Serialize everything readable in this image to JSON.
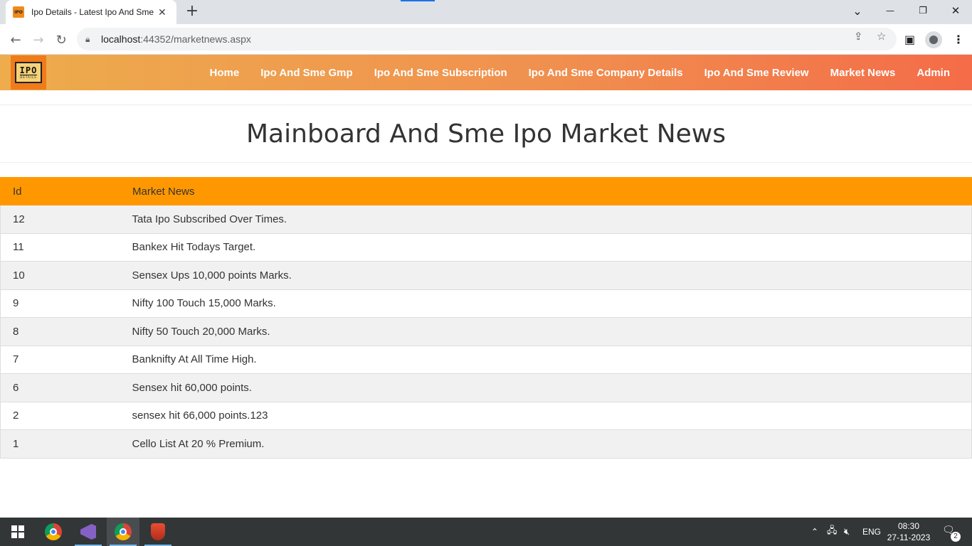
{
  "browser": {
    "tab_title": "Ipo Details - Latest Ipo And Sme",
    "tab_close": "✕",
    "new_tab": "+",
    "url_host": "localhost",
    "url_rest": ":44352/marketnews.aspx",
    "window_controls": {
      "minimize": "—",
      "restore": "❐",
      "close": "✕",
      "tab_list": "⌄"
    }
  },
  "site": {
    "logo_main": "IPO",
    "logo_sub": "DETAILS",
    "nav": [
      "Home",
      "Ipo And Sme Gmp",
      "Ipo And Sme Subscription",
      "Ipo And Sme Company Details",
      "Ipo And Sme Review",
      "Market News",
      "Admin"
    ],
    "page_title": "Mainboard And Sme Ipo Market News"
  },
  "table": {
    "headers": [
      "Id",
      "Market News"
    ],
    "rows": [
      [
        "12",
        "Tata Ipo Subscribed Over Times."
      ],
      [
        "11",
        "Bankex Hit Todays Target."
      ],
      [
        "10",
        "Sensex Ups 10,000 points Marks."
      ],
      [
        "9",
        "Nifty 100 Touch 15,000 Marks."
      ],
      [
        "8",
        "Nifty 50 Touch 20,000 Marks."
      ],
      [
        "7",
        "Banknifty At All Time High."
      ],
      [
        "6",
        "Sensex hit 60,000 points."
      ],
      [
        "2",
        "sensex hit 66,000 points.123"
      ],
      [
        "1",
        "Cello List At 20 % Premium."
      ]
    ]
  },
  "taskbar": {
    "language": "ENG",
    "time": "08:30",
    "date": "27-11-2023",
    "notification_count": "2"
  },
  "colors": {
    "table_header": "#ff9800",
    "nav_gradient_start": "#eeac4c",
    "nav_gradient_end": "#f46c48"
  }
}
